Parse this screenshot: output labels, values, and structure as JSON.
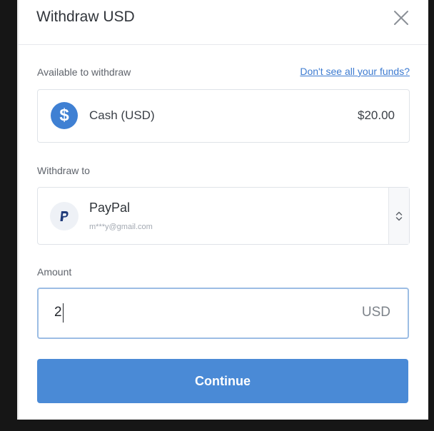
{
  "modal": {
    "title": "Withdraw USD",
    "close_icon": "close-icon"
  },
  "available": {
    "label": "Available to withdraw",
    "link": "Don't see all your funds?",
    "account_icon": "dollar-coin-icon",
    "account_symbol": "$",
    "account_name": "Cash (USD)",
    "account_amount": "$20.00"
  },
  "withdraw_to": {
    "label": "Withdraw to",
    "method_icon": "paypal-icon",
    "method_name": "PayPal",
    "method_email": "m***y@gmail.com",
    "stepper_icon": "chevron-up-down-icon"
  },
  "amount": {
    "label": "Amount",
    "value": "2",
    "unit": "USD"
  },
  "actions": {
    "continue_label": "Continue"
  },
  "colors": {
    "accent": "#4a8ad6",
    "link": "#3d7bd1",
    "focus_border": "#9cbde4"
  }
}
